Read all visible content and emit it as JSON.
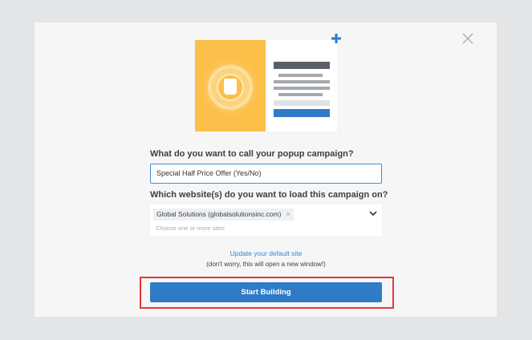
{
  "modal": {
    "name_question": "What do you want to call your popup campaign?",
    "name_value": "Special Half Price Offer (Yes/No)",
    "website_question": "Which website(s) do you want to load this campaign on?",
    "selected_site": "Global Solutions (globalsolutionsinc.com)",
    "remove_tag_glyph": "×",
    "sites_placeholder": "Choose one or more sites",
    "update_link": "Update your default site",
    "update_note": "(don't worry, this will open a new window!)",
    "start_button": "Start Building"
  },
  "colors": {
    "accent_blue": "#2f7bc8",
    "illustration_yellow": "#fcbf49",
    "highlight_red": "#e53935"
  },
  "icons": [
    "close-icon",
    "plus-icon",
    "chevron-down-icon",
    "remove-tag-icon"
  ]
}
